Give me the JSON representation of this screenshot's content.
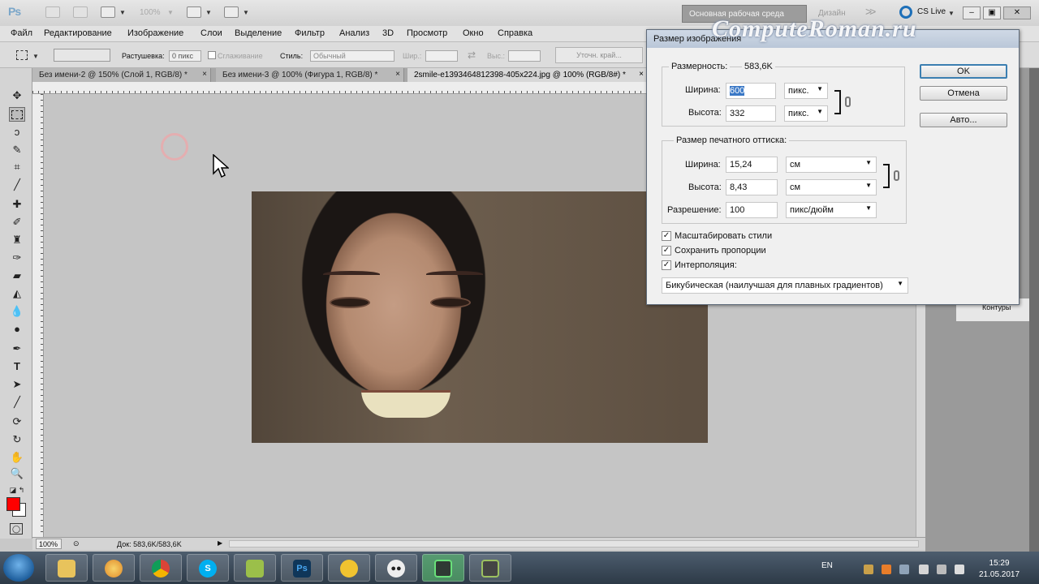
{
  "app": {
    "logo": "Ps",
    "zoom_display": "100%",
    "workspace_button": "Основная рабочая среда",
    "design_button": "Дизайн",
    "more_chevron": ">>",
    "cs_live": "CS Live",
    "min": "–",
    "restore": "▣",
    "close": "✕"
  },
  "menu": [
    "Файл",
    "Редактирование",
    "Изображение",
    "Слои",
    "Выделение",
    "Фильтр",
    "Анализ",
    "3D",
    "Просмотр",
    "Окно",
    "Справка"
  ],
  "options": {
    "feather_label": "Растушевка:",
    "feather_value": "0 пикс",
    "antialias_label": "Сглаживание",
    "style_label": "Стиль:",
    "style_value": "Обычный",
    "width_label": "Шир.:",
    "height_label": "Выс.:",
    "refine_edge": "Уточн. край..."
  },
  "tabs": [
    {
      "label": "Без имени-2 @ 150% (Слой 1, RGB/8) *",
      "close": "×"
    },
    {
      "label": "Без имени-3 @ 100% (Фигура 1, RGB/8) *",
      "close": "×"
    },
    {
      "label": "2smile-e1393464812398-405x224.jpg @ 100% (RGB/8#) *",
      "close": "×"
    }
  ],
  "status": {
    "zoom": "100%",
    "doc": "Док: 583,6K/583,6K"
  },
  "panels": {
    "contours": "Контуры"
  },
  "dialog": {
    "title": "Размер изображения",
    "watermark": "ComputeRoman.ru",
    "pixel_dims_label": "Размерность:",
    "pixel_dims_value": "583,6K",
    "width_label": "Ширина:",
    "width_value": "600",
    "width_unit": "пикс.",
    "height_label": "Высота:",
    "height_value": "332",
    "height_unit": "пикс.",
    "print_size_label": "Размер печатного оттиска:",
    "doc_width_label": "Ширина:",
    "doc_width_value": "15,24",
    "doc_width_unit": "см",
    "doc_height_label": "Высота:",
    "doc_height_value": "8,43",
    "doc_height_unit": "см",
    "resolution_label": "Разрешение:",
    "resolution_value": "100",
    "resolution_unit": "пикс/дюйм",
    "scale_styles": "Масштабировать стили",
    "constrain": "Сохранить пропорции",
    "resample": "Интерполяция:",
    "resample_method": "Бикубическая (наилучшая для плавных градиентов)",
    "ok": "OK",
    "cancel": "Отмена",
    "auto": "Авто..."
  },
  "taskbar": {
    "lang": "EN",
    "time": "15:29",
    "date": "21.05.2017",
    "ps_icon": "Ps"
  }
}
